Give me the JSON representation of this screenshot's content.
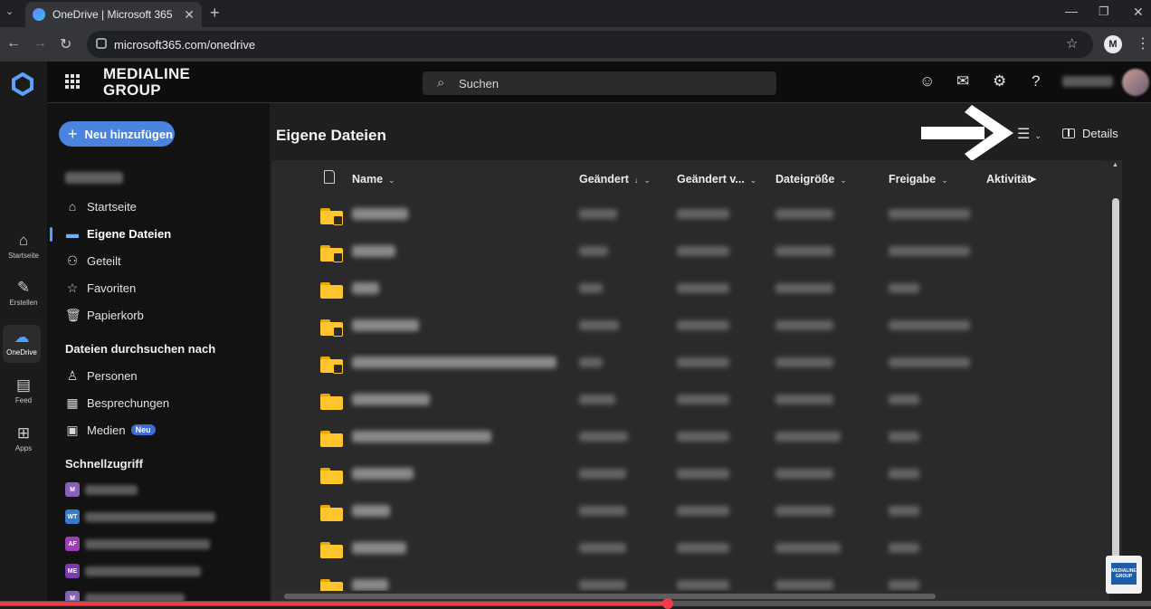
{
  "browser": {
    "tab_title": "OneDrive | Microsoft 365",
    "url": "microsoft365.com/onedrive"
  },
  "rail": {
    "items": [
      {
        "label": "Startseite",
        "icon": "home-icon"
      },
      {
        "label": "Erstellen",
        "icon": "pen-icon"
      },
      {
        "label": "OneDrive",
        "icon": "cloud-icon"
      },
      {
        "label": "Feed",
        "icon": "feed-icon"
      },
      {
        "label": "Apps",
        "icon": "apps-icon"
      }
    ]
  },
  "header": {
    "brand_line1": "MEDIALINE",
    "brand_line2": "GROUP",
    "search_placeholder": "Suchen"
  },
  "sidebar": {
    "new_button": "Neu hinzufügen",
    "nav": [
      {
        "label": "Startseite",
        "icon": "home-icon"
      },
      {
        "label": "Eigene Dateien",
        "icon": "folder-icon",
        "active": true
      },
      {
        "label": "Geteilt",
        "icon": "people-icon"
      },
      {
        "label": "Favoriten",
        "icon": "star-icon"
      },
      {
        "label": "Papierkorb",
        "icon": "trash-icon"
      }
    ],
    "browse_heading": "Dateien durchsuchen nach",
    "browse": [
      {
        "label": "Personen",
        "icon": "person-icon"
      },
      {
        "label": "Besprechungen",
        "icon": "calendar-icon"
      },
      {
        "label": "Medien",
        "icon": "image-icon",
        "badge": "Neu"
      }
    ],
    "quick_heading": "Schnellzugriff",
    "quick": [
      {
        "initials": "M",
        "color": "#8a5fb8"
      },
      {
        "initials": "WT",
        "color": "#3a78c8"
      },
      {
        "initials": "AF",
        "color": "#a03ab8"
      },
      {
        "initials": "ME",
        "color": "#7a3ab0"
      },
      {
        "initials": "M",
        "color": "#8a5fb8"
      }
    ]
  },
  "main": {
    "title": "Eigene Dateien",
    "details_label": "Details",
    "columns": {
      "name": "Name",
      "modified": "Geändert",
      "modified_by": "Geändert v...",
      "size": "Dateigröße",
      "sharing": "Freigabe",
      "activity": "Aktivität"
    },
    "rows": [
      {
        "shared": true
      },
      {
        "shared": true
      },
      {
        "shared": false
      },
      {
        "shared": true
      },
      {
        "shared": true
      },
      {
        "shared": false
      },
      {
        "shared": false
      },
      {
        "shared": false
      },
      {
        "shared": false
      },
      {
        "shared": false
      },
      {
        "shared": false
      }
    ]
  },
  "video": {
    "progress": 0.58
  },
  "logo_corner": "MEDIALINE GROUP"
}
